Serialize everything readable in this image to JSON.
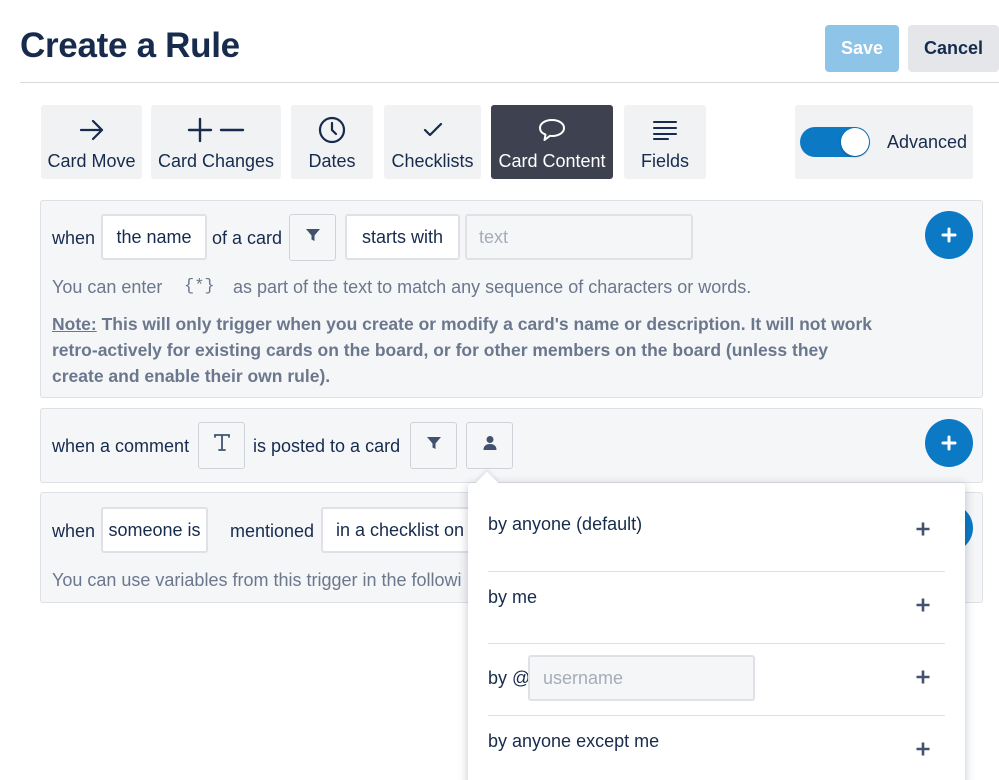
{
  "header": {
    "title": "Create a Rule",
    "save_label": "Save",
    "cancel_label": "Cancel"
  },
  "tabs": [
    {
      "label": "Card Move",
      "icon": "arrow-right-icon",
      "active": false
    },
    {
      "label": "Card Changes",
      "icon": "plus-minus-icon",
      "active": false
    },
    {
      "label": "Dates",
      "icon": "clock-icon",
      "active": false
    },
    {
      "label": "Checklists",
      "icon": "checkmark-icon",
      "active": false
    },
    {
      "label": "Card Content",
      "icon": "speech-bubble-icon",
      "active": true
    },
    {
      "label": "Fields",
      "icon": "lines-icon",
      "active": false
    }
  ],
  "advanced": {
    "label": "Advanced",
    "on": true
  },
  "trigger1": {
    "when": "when",
    "field": "the name",
    "of_card": "of a card",
    "operator": "starts with",
    "text_placeholder": "text",
    "hint_pre": "You can enter",
    "hint_code": "{*}",
    "hint_post": "as part of the text to match any sequence of characters or words.",
    "note_label": "Note:",
    "note_text": " This will only trigger when you create or modify a card's name or description. It will not work retro-actively for existing cards on the board, or for other members on the board (unless they create and enable their own rule)."
  },
  "trigger2": {
    "when_comment": "when a comment",
    "posted": "is posted to a card"
  },
  "trigger3": {
    "when": "when",
    "who": "someone is",
    "mentioned": "mentioned",
    "where": "in a checklist on",
    "hint": "You can use variables from this trigger in the followi"
  },
  "dropdown": {
    "items": [
      {
        "label": "by anyone (default)"
      },
      {
        "label": "by me"
      },
      {
        "label": "by @",
        "placeholder": "username"
      },
      {
        "label": "by anyone except me"
      }
    ]
  },
  "colors": {
    "accent": "#0c79c4",
    "save_disabled": "#8ec4e8",
    "active_tab": "#3e4250"
  }
}
